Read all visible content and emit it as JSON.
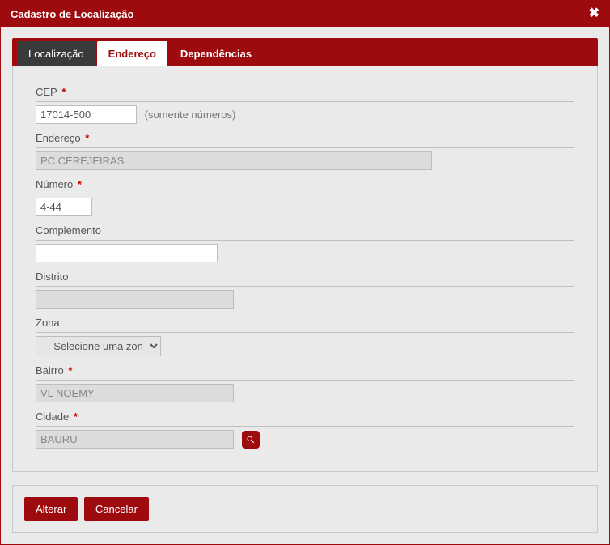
{
  "dialog": {
    "title": "Cadastro de Localização"
  },
  "tabs": {
    "localizacao": "Localização",
    "endereco": "Endereço",
    "dependencias": "Dependências"
  },
  "form": {
    "cep": {
      "label": "CEP",
      "value": "17014-500",
      "hint": "(somente números)"
    },
    "endereco": {
      "label": "Endereço",
      "value": "PC CEREJEIRAS"
    },
    "numero": {
      "label": "Número",
      "value": "4-44"
    },
    "complemento": {
      "label": "Complemento",
      "value": ""
    },
    "distrito": {
      "label": "Distrito",
      "value": ""
    },
    "zona": {
      "label": "Zona",
      "placeholder": "-- Selecione uma zona --"
    },
    "bairro": {
      "label": "Bairro",
      "value": "VL NOEMY"
    },
    "cidade": {
      "label": "Cidade",
      "value": "BAURU"
    }
  },
  "actions": {
    "alterar": "Alterar",
    "cancelar": "Cancelar"
  }
}
